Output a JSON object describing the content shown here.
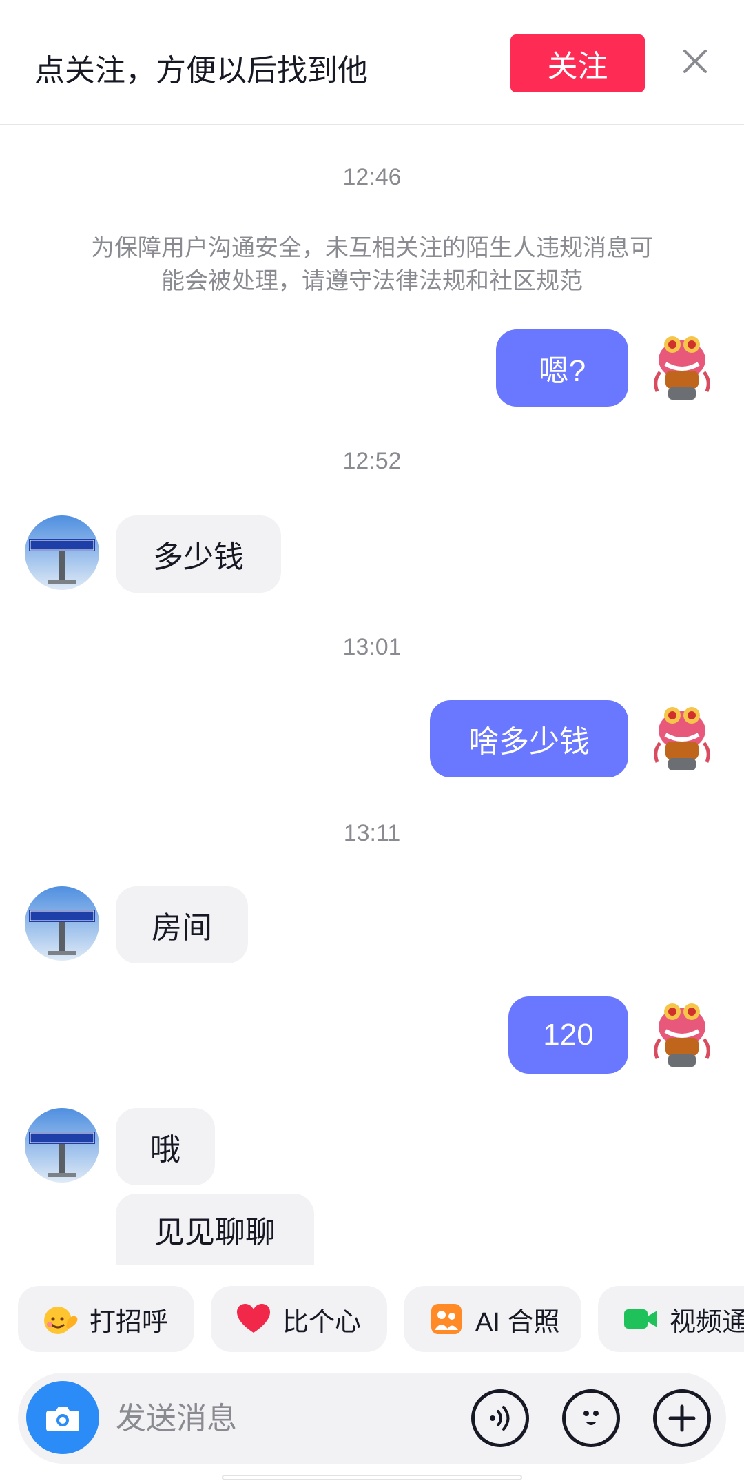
{
  "banner": {
    "text": "点关注，方便以后找到他",
    "follow_label": "关注"
  },
  "chat": {
    "timestamps": [
      "12:46",
      "12:52",
      "13:01",
      "13:11"
    ],
    "notice": "为保障用户沟通安全，未互相关注的陌生人违规消息可能会被处理，请遵守法律法规和社区规范",
    "messages": [
      {
        "from": "me",
        "text": "嗯?"
      },
      {
        "from": "other",
        "text": "多少钱"
      },
      {
        "from": "me",
        "text": "啥多少钱"
      },
      {
        "from": "other",
        "text": "房间"
      },
      {
        "from": "me",
        "text": "120"
      },
      {
        "from": "other",
        "text": "哦"
      },
      {
        "from": "other",
        "text": "见见聊聊"
      }
    ]
  },
  "quick_replies": [
    {
      "label": "打招呼",
      "icon": "wave-hand-emoji-icon"
    },
    {
      "label": "比个心",
      "icon": "heart-icon"
    },
    {
      "label": "AI 合照",
      "icon": "ai-photo-icon"
    },
    {
      "label": "视频通",
      "icon": "video-call-icon"
    }
  ],
  "input": {
    "placeholder": "发送消息"
  },
  "colors": {
    "accent": "#fe2c55",
    "out_bubble": "#6a77ff",
    "camera": "#2b8cf7"
  }
}
